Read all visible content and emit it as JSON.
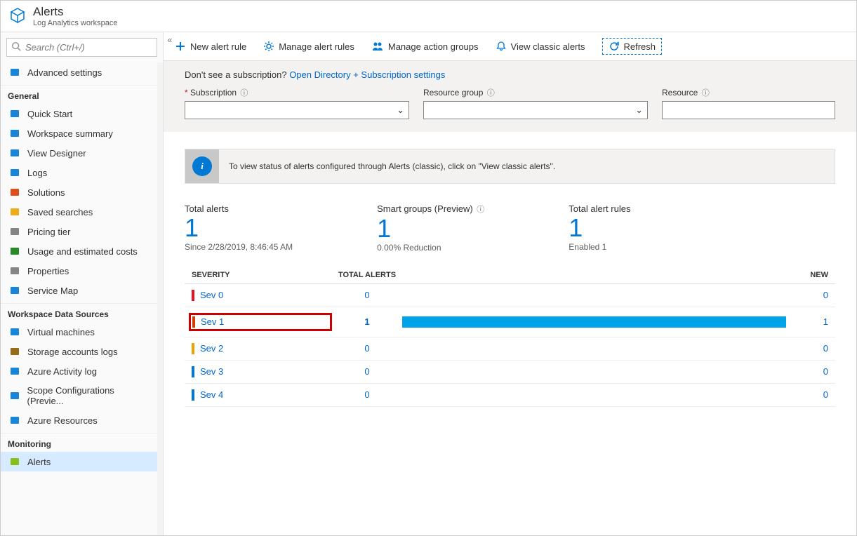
{
  "header": {
    "title": "Alerts",
    "subtitle": "Log Analytics workspace"
  },
  "search": {
    "placeholder": "Search (Ctrl+/)"
  },
  "sidebar": {
    "top": [
      {
        "icon": "gear",
        "label": "Advanced settings"
      }
    ],
    "groups": [
      {
        "title": "General",
        "items": [
          {
            "icon": "cloud",
            "label": "Quick Start",
            "color": "#0078d4"
          },
          {
            "icon": "summary",
            "label": "Workspace summary",
            "color": "#0078d4"
          },
          {
            "icon": "designer",
            "label": "View Designer",
            "color": "#0078d4"
          },
          {
            "icon": "logs",
            "label": "Logs",
            "color": "#0078d4"
          },
          {
            "icon": "solutions",
            "label": "Solutions",
            "color": "#d83b01"
          },
          {
            "icon": "star",
            "label": "Saved searches",
            "color": "#eaa300"
          },
          {
            "icon": "bars",
            "label": "Pricing tier",
            "color": "#777"
          },
          {
            "icon": "cost",
            "label": "Usage and estimated costs",
            "color": "#107c10"
          },
          {
            "icon": "bars",
            "label": "Properties",
            "color": "#777"
          },
          {
            "icon": "map",
            "label": "Service Map",
            "color": "#0078d4"
          }
        ]
      },
      {
        "title": "Workspace Data Sources",
        "items": [
          {
            "icon": "vm",
            "label": "Virtual machines",
            "color": "#0078d4"
          },
          {
            "icon": "storage",
            "label": "Storage accounts logs",
            "color": "#8a5c00"
          },
          {
            "icon": "activity",
            "label": "Azure Activity log",
            "color": "#0078d4"
          },
          {
            "icon": "scope",
            "label": "Scope Configurations (Previe...",
            "color": "#0078d4"
          },
          {
            "icon": "cube",
            "label": "Azure Resources",
            "color": "#0078d4"
          }
        ]
      },
      {
        "title": "Monitoring",
        "items": [
          {
            "icon": "alerts",
            "label": "Alerts",
            "color": "#7fba00",
            "selected": true
          }
        ]
      }
    ]
  },
  "toolbar": {
    "new_rule": "New alert rule",
    "manage_rules": "Manage alert rules",
    "manage_groups": "Manage action groups",
    "view_classic": "View classic alerts",
    "refresh": "Refresh"
  },
  "filterbar": {
    "hint_pre": "Don't see a subscription? ",
    "hint_link": "Open Directory + Subscription settings",
    "subscription": "Subscription",
    "resource_group": "Resource group",
    "resource": "Resource"
  },
  "info_text": "To view status of alerts configured through Alerts (classic), click on \"View classic alerts\".",
  "stats": {
    "total_alerts": {
      "label": "Total alerts",
      "value": "1",
      "sub": "Since 2/28/2019, 8:46:45 AM"
    },
    "smart_groups": {
      "label": "Smart groups (Preview)",
      "value": "1",
      "sub": "0.00% Reduction"
    },
    "total_rules": {
      "label": "Total alert rules",
      "value": "1",
      "sub": "Enabled 1"
    }
  },
  "columns": {
    "severity": "Severity",
    "total": "Total Alerts",
    "new": "New"
  },
  "rows": [
    {
      "name": "Sev 0",
      "color": "#e81123",
      "total": "0",
      "new": "0",
      "bar": 0,
      "highlight": false
    },
    {
      "name": "Sev 1",
      "color": "#d83b01",
      "total": "1",
      "new": "1",
      "bar": 100,
      "highlight": true
    },
    {
      "name": "Sev 2",
      "color": "#eaa300",
      "total": "0",
      "new": "0",
      "bar": 0,
      "highlight": false
    },
    {
      "name": "Sev 3",
      "color": "#0078d4",
      "total": "0",
      "new": "0",
      "bar": 0,
      "highlight": false
    },
    {
      "name": "Sev 4",
      "color": "#0078d4",
      "total": "0",
      "new": "0",
      "bar": 0,
      "highlight": false
    }
  ]
}
